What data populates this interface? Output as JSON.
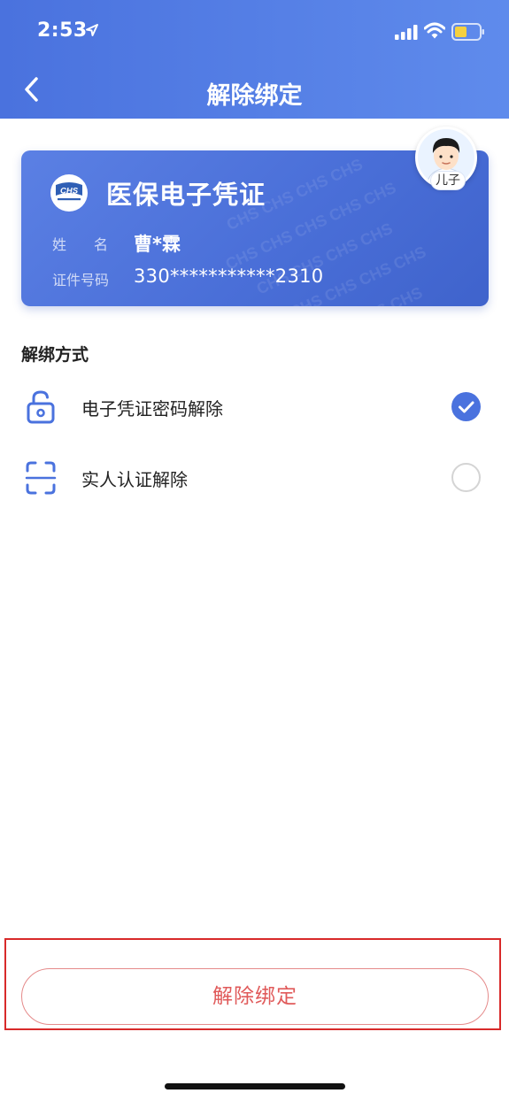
{
  "status_bar": {
    "time": "2:53"
  },
  "nav": {
    "title": "解除绑定"
  },
  "card": {
    "logo_text": "CHS",
    "title": "医保电子凭证",
    "name_label": "姓名",
    "name_value": "曹*霖",
    "id_label": "证件号码",
    "id_value": "330***********2310",
    "avatar_tag": "儿子"
  },
  "section": {
    "title": "解绑方式"
  },
  "options": [
    {
      "label": "电子凭证密码解除",
      "icon": "unlock-icon",
      "selected": true
    },
    {
      "label": "实人认证解除",
      "icon": "face-scan-icon",
      "selected": false
    }
  ],
  "footer": {
    "button_label": "解除绑定"
  },
  "colors": {
    "primary": "#4a72de",
    "danger": "#e05a5a",
    "highlight": "#d82a2a"
  }
}
